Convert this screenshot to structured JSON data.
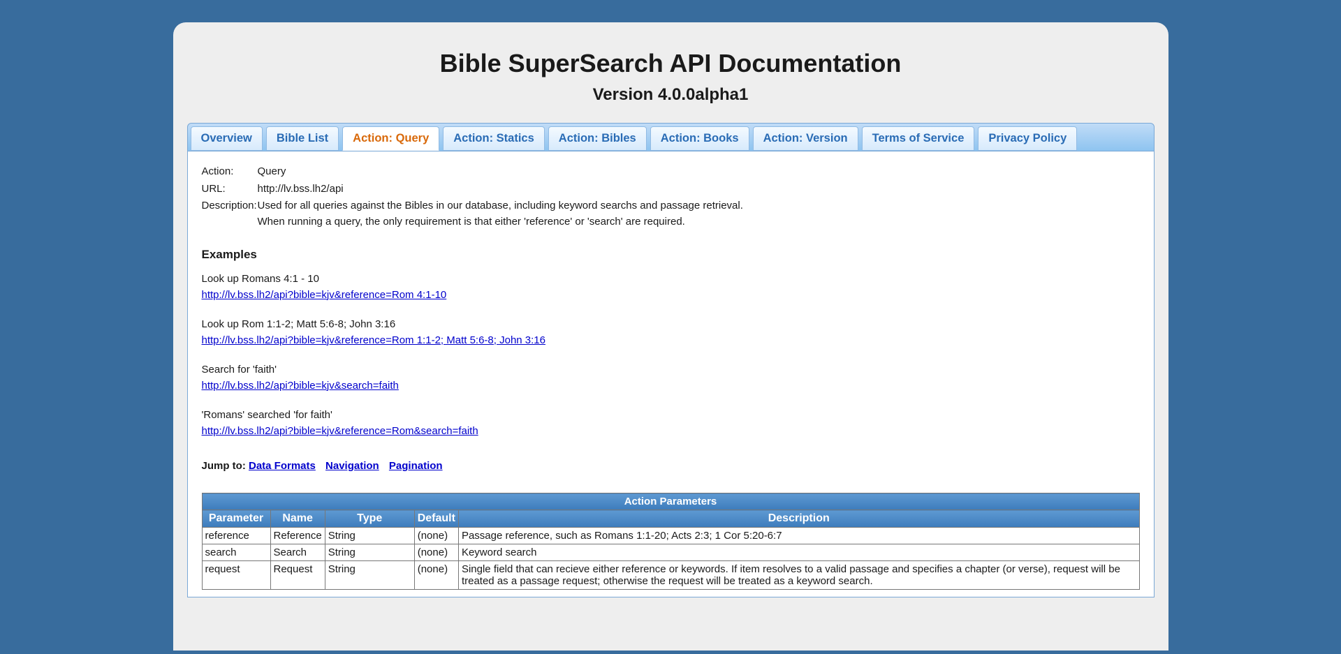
{
  "header": {
    "title": "Bible SuperSearch API Documentation",
    "version": "Version 4.0.0alpha1"
  },
  "tabs": [
    {
      "label": "Overview",
      "active": false
    },
    {
      "label": "Bible List",
      "active": false
    },
    {
      "label": "Action: Query",
      "active": true
    },
    {
      "label": "Action: Statics",
      "active": false
    },
    {
      "label": "Action: Bibles",
      "active": false
    },
    {
      "label": "Action: Books",
      "active": false
    },
    {
      "label": "Action: Version",
      "active": false
    },
    {
      "label": "Terms of Service",
      "active": false
    },
    {
      "label": "Privacy Policy",
      "active": false
    }
  ],
  "info": {
    "action_label": "Action:",
    "action_value": "Query",
    "url_label": "URL:",
    "url_value": "http://lv.bss.lh2/api",
    "desc_label": "Description:",
    "desc_line1": "Used for all queries against the Bibles in our database, including keyword searchs and passage retrieval.",
    "desc_line2": "When running a query, the only requirement is that either 'reference' or 'search' are required."
  },
  "examples_heading": "Examples",
  "examples": [
    {
      "text": "Look up Romans 4:1 - 10",
      "link": "http://lv.bss.lh2/api?bible=kjv&reference=Rom 4:1-10 "
    },
    {
      "text": "Look up Rom 1:1-2; Matt 5:6-8; John 3:16",
      "link": "http://lv.bss.lh2/api?bible=kjv&reference=Rom 1:1-2; Matt 5:6-8; John 3:16 "
    },
    {
      "text": "Search for 'faith'",
      "link": "http://lv.bss.lh2/api?bible=kjv&search=faith "
    },
    {
      "text": "'Romans' searched 'for faith'",
      "link": "http://lv.bss.lh2/api?bible=kjv&reference=Rom&search=faith "
    }
  ],
  "jumpto": {
    "label": "Jump to: ",
    "links": [
      "Data Formats",
      "Navigation",
      "Pagination"
    ]
  },
  "table": {
    "title": "Action Parameters",
    "columns": [
      "Parameter",
      "Name",
      "Type",
      "Default",
      "Description"
    ],
    "rows": [
      {
        "param": "reference",
        "name": "Reference",
        "type": "String",
        "def": "(none)",
        "desc": "Passage reference, such as Romans 1:1-20; Acts 2:3; 1 Cor 5:20-6:7"
      },
      {
        "param": "search",
        "name": "Search",
        "type": "String",
        "def": "(none)",
        "desc": "Keyword search"
      },
      {
        "param": "request",
        "name": "Request",
        "type": "String",
        "def": "(none)",
        "desc": "Single field that can recieve either reference or keywords. If item resolves to a valid passage and specifies a chapter (or verse), request will be treated as a passage request; otherwise the request will be treated as a keyword search."
      }
    ]
  }
}
